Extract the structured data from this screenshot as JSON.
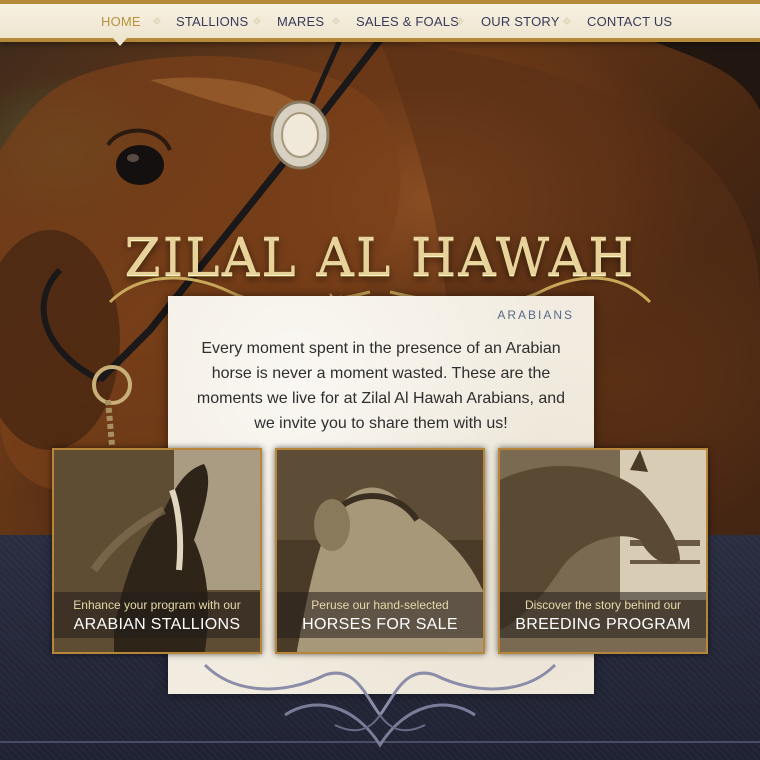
{
  "nav": {
    "items": [
      {
        "label": "HOME",
        "active": true
      },
      {
        "label": "STALLIONS",
        "active": false
      },
      {
        "label": "MARES",
        "active": false
      },
      {
        "label": "SALES & FOALS",
        "active": false
      },
      {
        "label": "OUR STORY",
        "active": false
      },
      {
        "label": "CONTACT US",
        "active": false
      }
    ],
    "accent_color": "#b8923d",
    "text_color": "#3a3a5a"
  },
  "brand": {
    "title": "ZILAL AL HAWAH",
    "subtitle": "ARABIANS"
  },
  "intro": {
    "text": "Every moment spent in the presence of an Arabian horse is never a moment wasted. These are the moments we live for at Zilal Al Hawah Arabians, and we invite you to share them with us!"
  },
  "cards": [
    {
      "small": "Enhance your program with our",
      "big": "ARABIAN STALLIONS"
    },
    {
      "small": "Peruse our hand-selected",
      "big": "HORSES FOR SALE"
    },
    {
      "small": "Discover the story behind our",
      "big": "BREEDING PROGRAM"
    }
  ],
  "colors": {
    "border_gold": "#b8863a",
    "band_dark": "#1f2232"
  }
}
